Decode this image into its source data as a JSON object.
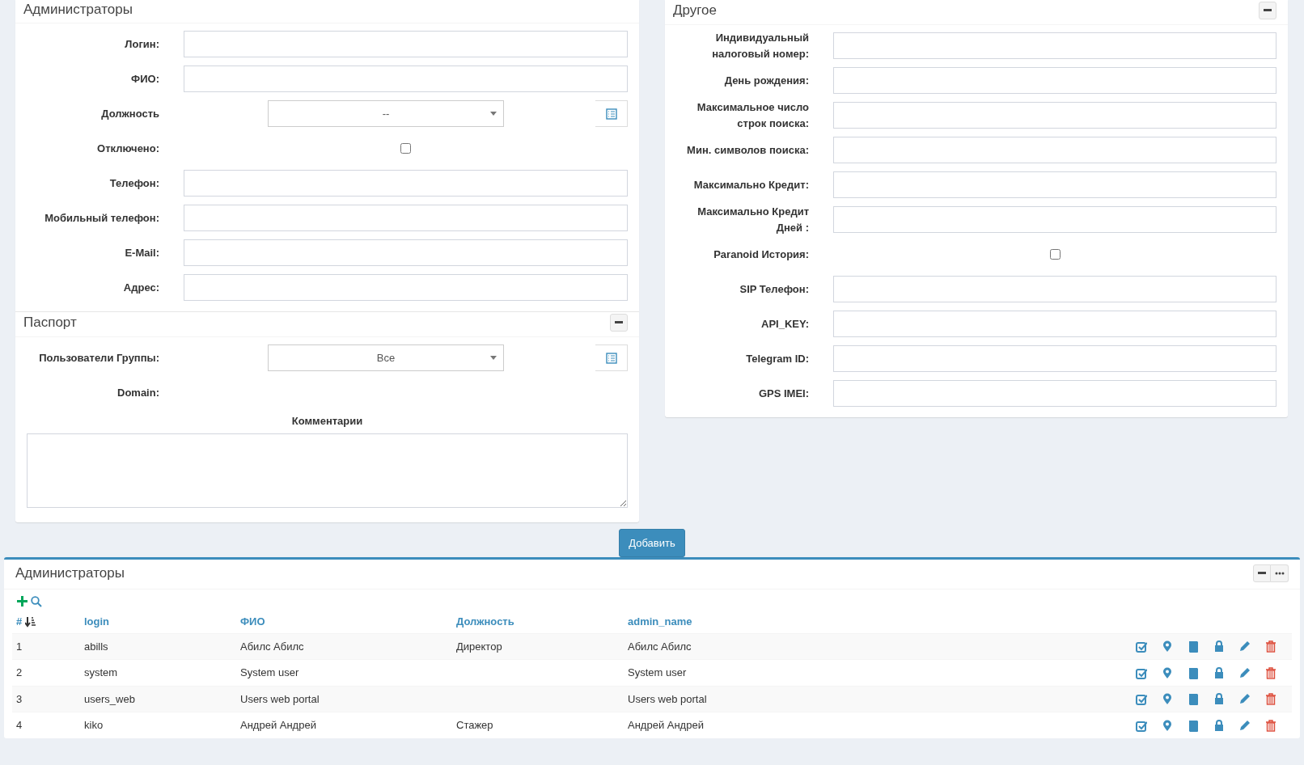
{
  "admin_form": {
    "title": "Администраторы",
    "fields": [
      {
        "kind": "input",
        "label": "Логин:"
      },
      {
        "kind": "input",
        "label": "ФИО:"
      },
      {
        "kind": "select",
        "label": "Должность",
        "value": "--"
      },
      {
        "kind": "checkbox",
        "label": "Отключено:",
        "checked": false
      },
      {
        "kind": "input",
        "label": "Телефон:"
      },
      {
        "kind": "input",
        "label": "Мобильный телефон:"
      },
      {
        "kind": "input",
        "label": "E-Mail:"
      },
      {
        "kind": "input",
        "label": "Адрес:"
      }
    ]
  },
  "passport": {
    "title": "Паспорт",
    "fields": [
      {
        "kind": "select",
        "label": "Пользователи Группы:",
        "value": "Все"
      },
      {
        "kind": "text",
        "label": "Domain:"
      }
    ],
    "comments_label": "Комментарии"
  },
  "other": {
    "title": "Другое",
    "fields": [
      {
        "kind": "input",
        "label": "Индивидуальный\nналоговый номер:"
      },
      {
        "kind": "input",
        "label": "День рождения:"
      },
      {
        "kind": "input",
        "label": "Максимальное число\nстрок поиска:"
      },
      {
        "kind": "input",
        "label": "Мин. символов поиска:"
      },
      {
        "kind": "input",
        "label": "Максимально Кредит:"
      },
      {
        "kind": "input",
        "label": "Максимально Кредит\nДней :"
      },
      {
        "kind": "checkbox",
        "label": "Paranoid История:",
        "checked": false
      },
      {
        "kind": "input",
        "label": "SIP Телефон:"
      },
      {
        "kind": "input",
        "label": "API_KEY:"
      },
      {
        "kind": "input",
        "label": "Telegram ID:"
      },
      {
        "kind": "input",
        "label": "GPS IMEI:"
      }
    ]
  },
  "submit_button": "Добавить",
  "admins_table": {
    "title": "Администраторы",
    "columns": [
      "#",
      "login",
      "ФИО",
      "Должность",
      "admin_name"
    ],
    "rows": [
      [
        "1",
        "abills",
        "Абилс Абилс",
        "Директор",
        "Абилс Абилс"
      ],
      [
        "2",
        "system",
        "System user",
        "",
        "System user"
      ],
      [
        "3",
        "users_web",
        "Users web portal",
        "",
        "Users web portal"
      ],
      [
        "4",
        "kiko",
        "Андрей Андрей",
        "Стажер",
        "Андрей Андрей"
      ]
    ]
  }
}
